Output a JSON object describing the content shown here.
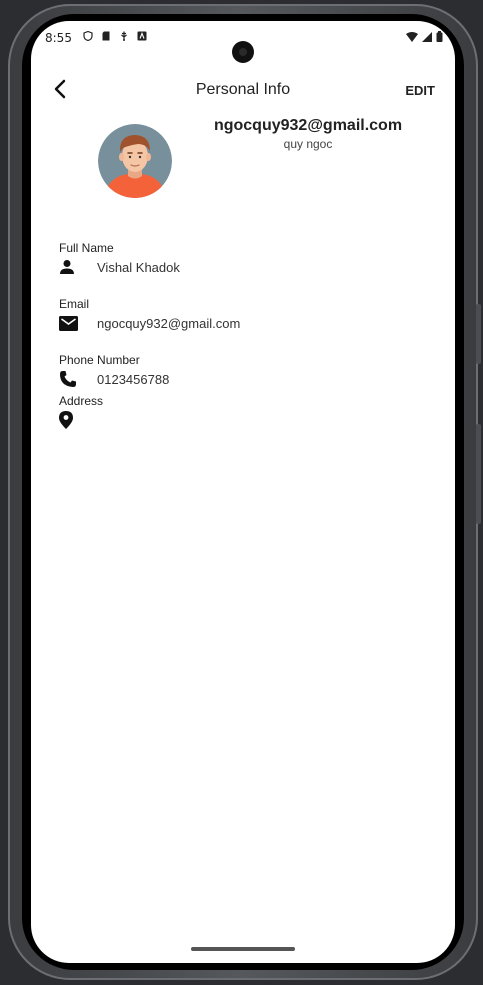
{
  "status_bar": {
    "time": "8:55"
  },
  "header": {
    "title": "Personal Info",
    "edit_label": "EDIT"
  },
  "profile": {
    "email": "ngocquy932@gmail.com",
    "name": "quy ngoc"
  },
  "fields": [
    {
      "label": "Full Name",
      "value": "Vishal Khadok",
      "icon": "person-icon"
    },
    {
      "label": "Email",
      "value": "ngocquy932@gmail.com",
      "icon": "mail-icon"
    },
    {
      "label": "Phone Number",
      "value": "0123456788",
      "icon": "phone-icon"
    },
    {
      "label": "Address",
      "value": "",
      "icon": "location-pin-icon"
    }
  ],
  "colors": {
    "screen_background": "#ffffff",
    "text_primary": "#222222",
    "avatar_background": "#78909c",
    "avatar_shirt": "#f4623a",
    "avatar_hair": "#a0522d",
    "avatar_skin": "#f5c6a5"
  }
}
